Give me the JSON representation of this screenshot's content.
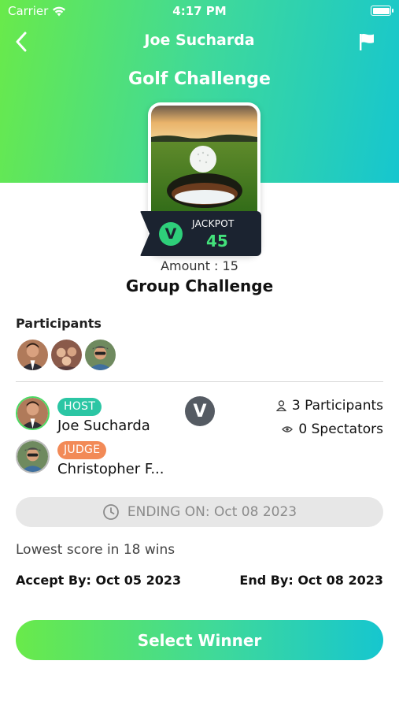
{
  "status_bar": {
    "carrier": "Carrier",
    "time": "4:17 PM"
  },
  "nav": {
    "title": "Joe Sucharda",
    "back_icon": "chevron-left-icon",
    "flag_icon": "flag-icon"
  },
  "challenge": {
    "title": "Golf Challenge",
    "jackpot_label": "JACKPOT",
    "jackpot_value": "45",
    "amount": "Amount : 15",
    "type": "Group Challenge"
  },
  "participants": {
    "label": "Participants",
    "avatars": [
      "participant-1",
      "participant-2",
      "participant-3"
    ]
  },
  "host": {
    "badge": "HOST",
    "name": "Joe Sucharda"
  },
  "judge": {
    "badge": "JUDGE",
    "name": "Christopher F..."
  },
  "stats": {
    "participants": "3 Participants",
    "spectators": "0 Spectators"
  },
  "ending": {
    "text": "ENDING ON: Oct 08 2023"
  },
  "rule": "Lowest score in 18 wins",
  "dates": {
    "accept_by": "Accept By: Oct 05 2023",
    "end_by": "End By: Oct 08 2023"
  },
  "actions": {
    "select_winner": "Select Winner"
  },
  "colors": {
    "gradient_start": "#69ea4a",
    "gradient_end": "#16c6cf",
    "host_badge": "#2bc6a4",
    "judge_badge": "#f28a57",
    "jackpot_value": "#43e27b"
  }
}
